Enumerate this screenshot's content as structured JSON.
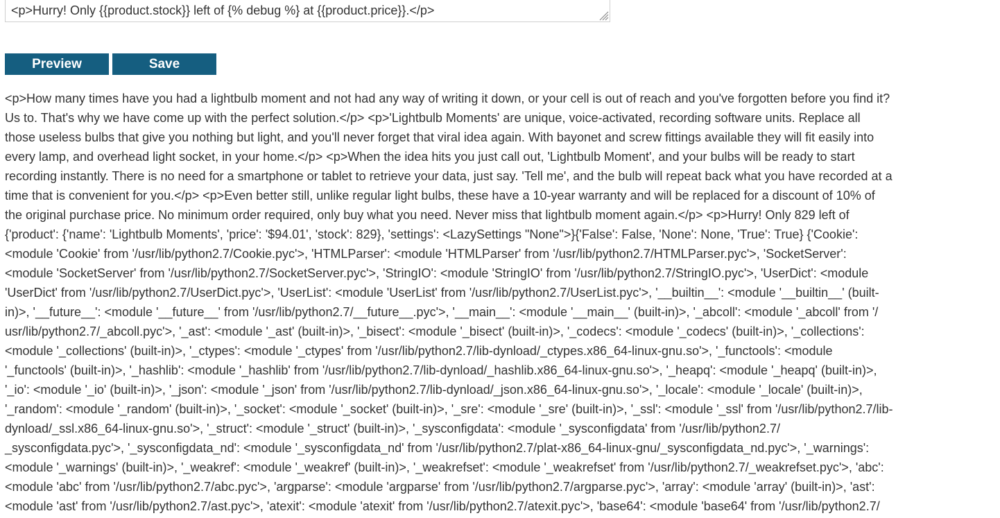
{
  "template_editor": {
    "visible_text": "<p>Hurry! Only {{product.stock}} left of {% debug %} at {{product.price}}.</p>"
  },
  "buttons": {
    "preview_label": "Preview",
    "save_label": "Save"
  },
  "preview_output": {
    "lines": [
      "<p>How many times have you had a lightbulb moment and not had any way of writing it down, or your cell is out of reach and you've forgotten before you find it?",
      "Us to. That's why we have come up with the perfect solution.</p> <p>'Lightbulb Moments' are unique, voice-activated, recording software units. Replace all",
      "those useless bulbs that give you nothing but light, and you'll never forget that viral idea again. With bayonet and screw fittings available they will fit easily into",
      "every lamp, and overhead light socket, in your home.</p> <p>When the idea hits you just call out, 'Lightbulb Moment', and your bulbs will be ready to start",
      "recording instantly. There is no need for a smartphone or tablet to retrieve your data, just say. 'Tell me', and the bulb will repeat back what you have recorded at a",
      "time that is convenient for you.</p> <p>Even better still, unlike regular light bulbs, these have a 10-year warranty and will be replaced for a discount of 10% of",
      "the original purchase price. No minimum order required, only buy what you need. Never miss that lightbulb moment again.</p> <p>Hurry! Only 829 left of",
      "{'product': {'name': 'Lightbulb Moments', 'price': '$94.01', 'stock': 829}, 'settings': <LazySettings \"None\">}{'False': False, 'None': None, 'True': True} {'Cookie':",
      "<module 'Cookie' from '/usr/lib/python2.7/Cookie.pyc'>, 'HTMLParser': <module 'HTMLParser' from '/usr/lib/python2.7/HTMLParser.pyc'>, 'SocketServer':",
      "<module 'SocketServer' from '/usr/lib/python2.7/SocketServer.pyc'>, 'StringIO': <module 'StringIO' from '/usr/lib/python2.7/StringIO.pyc'>, 'UserDict': <module",
      "'UserDict' from '/usr/lib/python2.7/UserDict.pyc'>, 'UserList': <module 'UserList' from '/usr/lib/python2.7/UserList.pyc'>, '__builtin__': <module '__builtin__' (built-",
      "in)>, '__future__': <module '__future__' from '/usr/lib/python2.7/__future__.pyc'>, '__main__': <module '__main__' (built-in)>, '_abcoll': <module '_abcoll' from '/",
      "usr/lib/python2.7/_abcoll.pyc'>, '_ast': <module '_ast' (built-in)>, '_bisect': <module '_bisect' (built-in)>, '_codecs': <module '_codecs' (built-in)>, '_collections':",
      "<module '_collections' (built-in)>, '_ctypes': <module '_ctypes' from '/usr/lib/python2.7/lib-dynload/_ctypes.x86_64-linux-gnu.so'>, '_functools': <module",
      "'_functools' (built-in)>, '_hashlib': <module '_hashlib' from '/usr/lib/python2.7/lib-dynload/_hashlib.x86_64-linux-gnu.so'>, '_heapq': <module '_heapq' (built-in)>,",
      "'_io': <module '_io' (built-in)>, '_json': <module '_json' from '/usr/lib/python2.7/lib-dynload/_json.x86_64-linux-gnu.so'>, '_locale': <module '_locale' (built-in)>,",
      "'_random': <module '_random' (built-in)>, '_socket': <module '_socket' (built-in)>, '_sre': <module '_sre' (built-in)>, '_ssl': <module '_ssl' from '/usr/lib/python2.7/lib-",
      "dynload/_ssl.x86_64-linux-gnu.so'>, '_struct': <module '_struct' (built-in)>, '_sysconfigdata': <module '_sysconfigdata' from '/usr/lib/python2.7/",
      "_sysconfigdata.pyc'>, '_sysconfigdata_nd': <module '_sysconfigdata_nd' from '/usr/lib/python2.7/plat-x86_64-linux-gnu/_sysconfigdata_nd.pyc'>, '_warnings':",
      "<module '_warnings' (built-in)>, '_weakref': <module '_weakref' (built-in)>, '_weakrefset': <module '_weakrefset' from '/usr/lib/python2.7/_weakrefset.pyc'>, 'abc':",
      "<module 'abc' from '/usr/lib/python2.7/abc.pyc'>, 'argparse': <module 'argparse' from '/usr/lib/python2.7/argparse.pyc'>, 'array': <module 'array' (built-in)>, 'ast':",
      "<module 'ast' from '/usr/lib/python2.7/ast.pyc'>, 'atexit': <module 'atexit' from '/usr/lib/python2.7/atexit.pyc'>, 'base64': <module 'base64' from '/usr/lib/python2.7/"
    ]
  },
  "colors": {
    "button_bg": "#155e80",
    "button_text": "#ffffff",
    "body_text": "#333333",
    "editor_border": "#cfcfcf"
  },
  "icons": {
    "editor_resize": "resize-grip-icon"
  }
}
